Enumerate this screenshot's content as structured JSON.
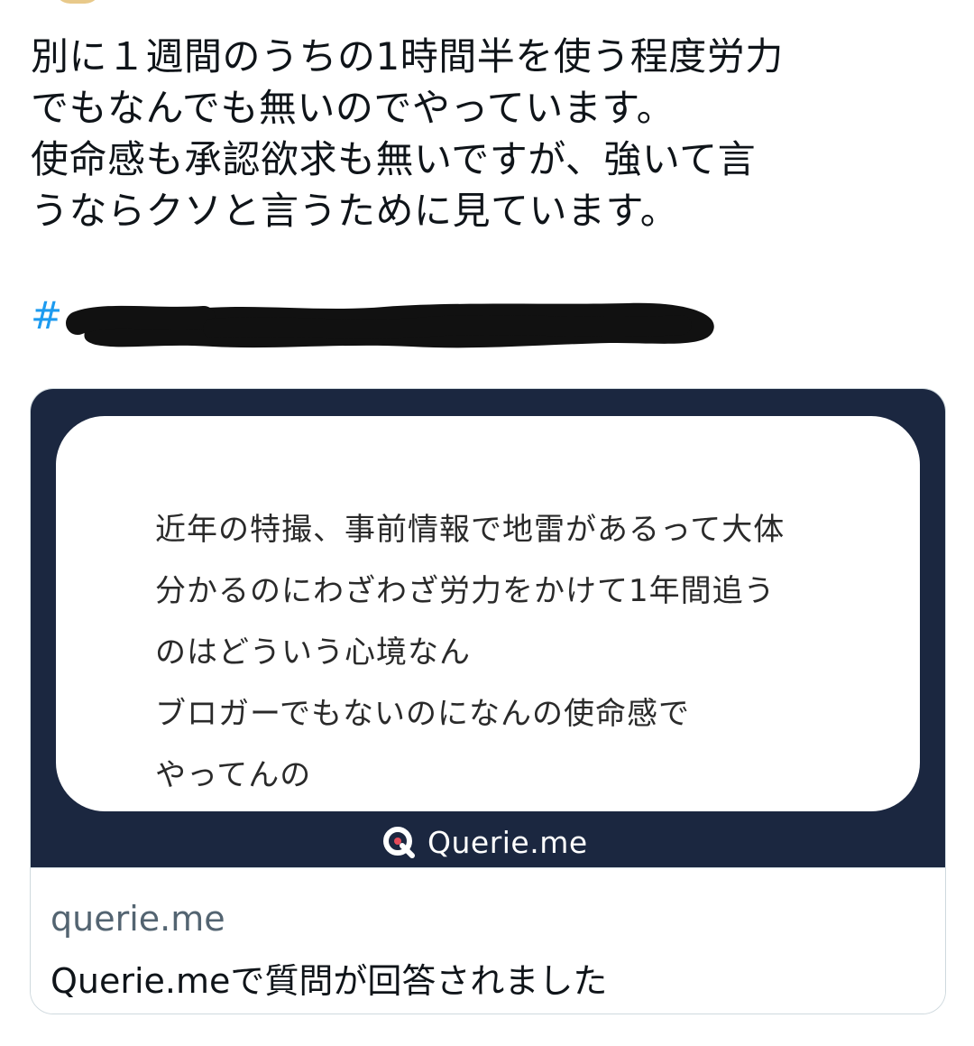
{
  "tweet": {
    "lines": [
      "別に１週間のうちの1時間半を使う程度労力",
      "でもなんでも無いのでやっています。",
      "使命感も承認欲求も無いですが、強いて言",
      "うならクソと言うために見ています。"
    ],
    "hashtag_prefix": "#"
  },
  "card": {
    "question_lines": [
      "近年の特撮、事前情報で地雷があるって大体",
      "分かるのにわざわざ労力をかけて1年間追う",
      "のはどういう心境なん",
      "ブロガーでもないのになんの使命感で",
      "やってんの"
    ],
    "brand_name": "Querie.me",
    "brand_icon": "querie-logo-icon",
    "domain": "querie.me",
    "title": "Querie.meで質問が回答されました"
  },
  "colors": {
    "text": "#0f1419",
    "muted": "#536471",
    "link": "#1d9bf0",
    "card_bg": "#1b2740",
    "border": "#cfd9de"
  }
}
